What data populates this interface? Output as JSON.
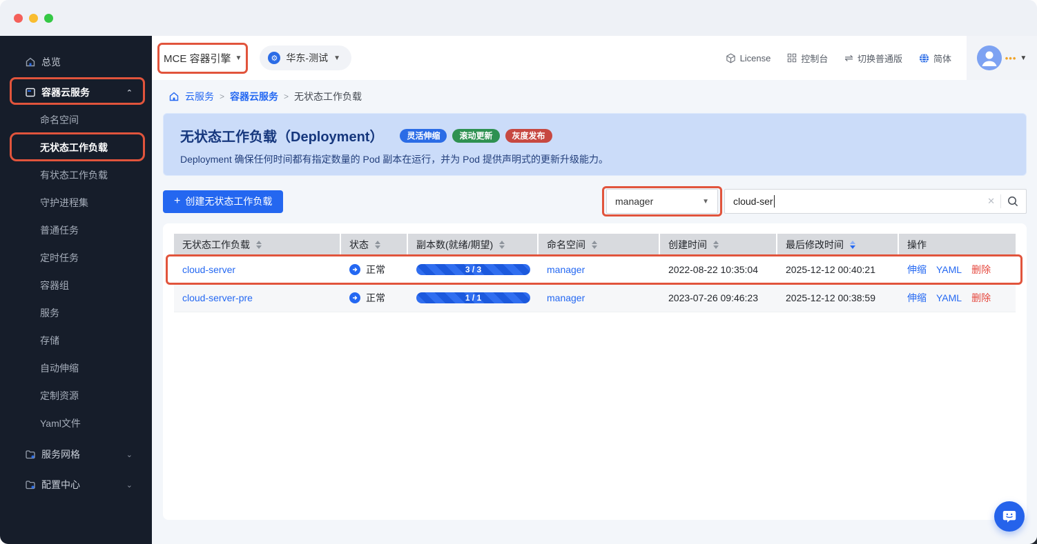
{
  "annotation_color": "#e1543c",
  "topnav": {
    "product_menu_label": "MCE 容器引擎",
    "cluster_label": "华东-测试",
    "links": [
      {
        "label": "License"
      },
      {
        "label": "控制台"
      },
      {
        "label": "切换普通版"
      },
      {
        "label": "简体"
      }
    ],
    "ellipsis": "•••"
  },
  "sidebar": {
    "overview_label": "总览",
    "container_group_label": "容器云服务",
    "children": [
      "命名空间",
      "无状态工作负载",
      "有状态工作负载",
      "守护进程集",
      "普通任务",
      "定时任务",
      "容器组",
      "服务",
      "存储",
      "自动伸缩",
      "定制资源",
      "Yaml文件"
    ],
    "active_child": "无状态工作负载",
    "service_mesh_label": "服务网格",
    "config_center_label": "配置中心"
  },
  "breadcrumb": {
    "items": [
      "云服务",
      "容器云服务",
      "无状态工作负载"
    ]
  },
  "banner": {
    "title": "无状态工作负载（Deployment）",
    "badges": [
      {
        "label": "灵活伸缩",
        "color": "#2b6ce6"
      },
      {
        "label": "滚动更新",
        "color": "#2e9151"
      },
      {
        "label": "灰度发布",
        "color": "#c74841"
      }
    ],
    "description": "Deployment 确保任何时间都有指定数量的 Pod 副本在运行，并为 Pod 提供声明式的更新升级能力。"
  },
  "toolbar": {
    "create_label": "创建无状态工作负载",
    "namespace_select_value": "manager",
    "search_value": "cloud-ser"
  },
  "table": {
    "columns": [
      {
        "label": "无状态工作负载",
        "sortable": true
      },
      {
        "label": "状态",
        "sortable": true
      },
      {
        "label": "副本数(就绪/期望)",
        "sortable": true
      },
      {
        "label": "命名空间",
        "sortable": true
      },
      {
        "label": "创建时间",
        "sortable": true
      },
      {
        "label": "最后修改时间",
        "sortable": true,
        "sorted": "desc"
      },
      {
        "label": "操作",
        "sortable": false
      }
    ],
    "rows": [
      {
        "name": "cloud-server",
        "status": "正常",
        "replicas": "3 / 3",
        "namespace": "manager",
        "created": "2022-08-22 10:35:04",
        "modified": "2025-12-12 00:40:21",
        "actions": [
          "伸缩",
          "YAML",
          "删除"
        ]
      },
      {
        "name": "cloud-server-pre",
        "status": "正常",
        "replicas": "1 / 1",
        "namespace": "manager",
        "created": "2023-07-26 09:46:23",
        "modified": "2025-12-12 00:38:59",
        "actions": [
          "伸缩",
          "YAML",
          "删除"
        ]
      }
    ]
  }
}
